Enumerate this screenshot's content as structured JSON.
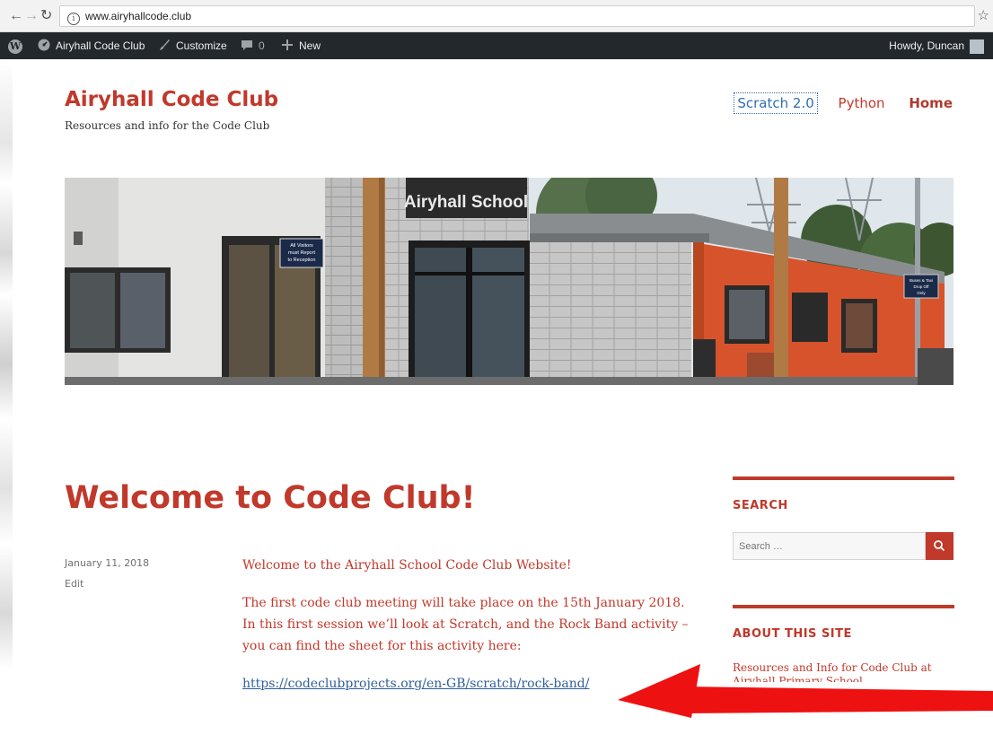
{
  "browser": {
    "url": "www.airyhallcode.club",
    "icons": [
      "back-icon",
      "forward-icon",
      "reload-icon",
      "info-icon",
      "bookmark-star-icon"
    ]
  },
  "admin_bar": {
    "site_name": "Airyhall Code Club",
    "customize": "Customize",
    "comments_count": "0",
    "new": "New",
    "greeting": "Howdy, Duncan"
  },
  "site": {
    "title": "Airyhall Code Club",
    "description": "Resources and info for the Code Club",
    "nav": [
      {
        "label": "Scratch 2.0"
      },
      {
        "label": "Python"
      },
      {
        "label": "Home"
      }
    ]
  },
  "header_image": {
    "sign_text": "Airyhall School",
    "notice_lines": [
      "All Visitors",
      "must Report",
      "to Reception"
    ],
    "small_sign_lines": [
      "Buses & Taxi",
      "Drop Off",
      "Only"
    ]
  },
  "post": {
    "title": "Welcome to Code Club!",
    "date": "January 11, 2018",
    "edit": "Edit",
    "paragraphs": [
      "Welcome to the Airyhall School Code Club Website!",
      "The first code club meeting will take place on the 15th January 2018. In this first session we’ll look at Scratch, and the Rock Band activity – you can find the sheet for this activity here:"
    ],
    "link": "https://codeclubprojects.org/en-GB/scratch/rock-band/"
  },
  "sidebar": {
    "search_title": "SEARCH",
    "search_placeholder": "Search …",
    "about_title": "ABOUT THIS SITE",
    "about_text": "Resources and Info for Code Club at Airyhall Primary School"
  },
  "colors": {
    "accent": "#c0392b",
    "admin_bar": "#23282d",
    "link": "#2f5f99",
    "annotation_arrow": "#ee1111"
  }
}
